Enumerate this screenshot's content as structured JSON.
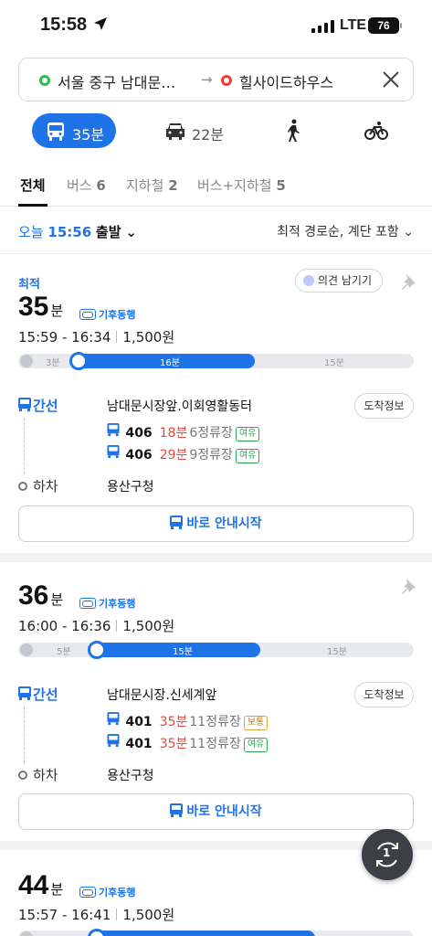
{
  "status_bar": {
    "time": "15:58",
    "network": "LTE",
    "battery": "76"
  },
  "search": {
    "from": "서울 중구 남대문…",
    "to": "힐사이드하우스",
    "arrow": "→"
  },
  "modes": [
    {
      "label": "35분",
      "icon": "bus-icon",
      "selected": true
    },
    {
      "label": "22분",
      "icon": "car-icon"
    },
    {
      "label": "",
      "icon": "walk-icon"
    },
    {
      "label": "",
      "icon": "bike-icon"
    }
  ],
  "tabs": [
    {
      "label": "전체",
      "count": ""
    },
    {
      "label": "버스",
      "count": "6"
    },
    {
      "label": "지하철",
      "count": "2"
    },
    {
      "label": "버스+지하철",
      "count": "5"
    }
  ],
  "sort": {
    "day": "오늘",
    "time": "15:56",
    "suffix": "출발",
    "option": "최적 경로순, 계단 포함"
  },
  "colors": {
    "accent": "#1f73e8",
    "red": "#e5483d",
    "green": "#2aa852"
  },
  "routes": [
    {
      "badge": "최적",
      "feedback": "의견 남기기",
      "duration": "35",
      "unit": "분",
      "climate": "기후동행",
      "times": "15:59 - 16:34",
      "fare": "1,500원",
      "seg_walk1": "3분",
      "seg_bus": "16분",
      "seg_walk2": "15분",
      "bus_fraction": 0.47,
      "type": "간선",
      "board_stop": "남대문시장앞.이회영활동터",
      "arrival": "도착정보",
      "buses": [
        {
          "num": "406",
          "min": "18분",
          "stops": "6정류장",
          "crowd": "여유"
        },
        {
          "num": "406",
          "min": "29분",
          "stops": "9정류장",
          "crowd": "여유"
        }
      ],
      "alight_label": "하차",
      "alight_stop": "용산구청",
      "start": "바로 안내시작"
    },
    {
      "duration": "36",
      "unit": "분",
      "climate": "기후동행",
      "times": "16:00 - 16:36",
      "fare": "1,500원",
      "seg_walk1": "5분",
      "seg_bus": "15분",
      "seg_walk2": "15분",
      "bus_fraction": 0.44,
      "type": "간선",
      "board_stop": "남대문시장.신세계앞",
      "arrival": "도착정보",
      "buses": [
        {
          "num": "401",
          "min": "35분",
          "stops": "11정류장",
          "crowd": "보통"
        },
        {
          "num": "401",
          "min": "35분",
          "stops": "11정류장",
          "crowd": "여유"
        }
      ],
      "alight_label": "하차",
      "alight_stop": "용산구청",
      "start": "바로 안내시작"
    },
    {
      "duration": "44",
      "unit": "분",
      "climate": "기후동행",
      "times": "15:57 - 16:41",
      "fare": "1,500원"
    }
  ],
  "fab": {
    "label": "1"
  }
}
